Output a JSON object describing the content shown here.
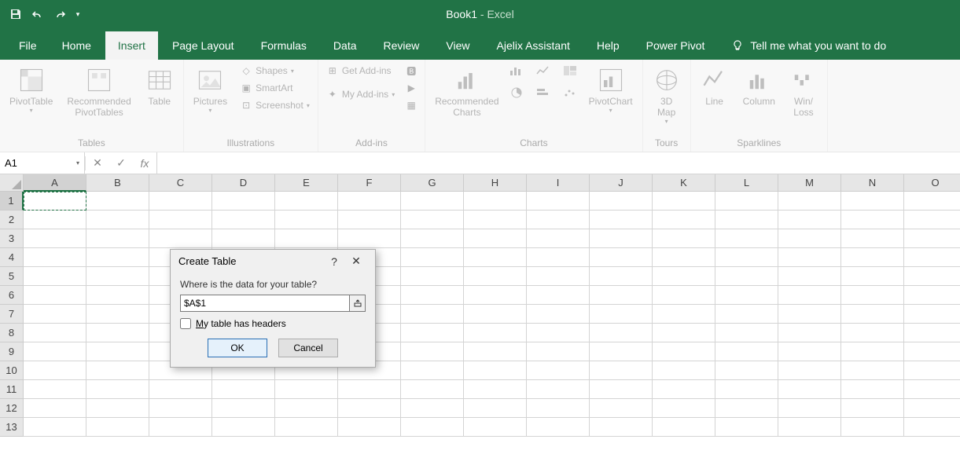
{
  "title": {
    "book": "Book1",
    "separator": " - ",
    "app": "Excel"
  },
  "tabs": {
    "file": "File",
    "home": "Home",
    "insert": "Insert",
    "page_layout": "Page Layout",
    "formulas": "Formulas",
    "data": "Data",
    "review": "Review",
    "view": "View",
    "ajelix": "Ajelix Assistant",
    "help": "Help",
    "powerpivot": "Power Pivot",
    "tellme": "Tell me what you want to do"
  },
  "ribbon": {
    "tables": {
      "pivot": "PivotTable",
      "recpivot": "Recommended\nPivotTables",
      "table": "Table",
      "label": "Tables"
    },
    "illustrations": {
      "pictures": "Pictures",
      "shapes": "Shapes",
      "smartart": "SmartArt",
      "screenshot": "Screenshot",
      "label": "Illustrations"
    },
    "addins": {
      "get": "Get Add-ins",
      "my": "My Add-ins",
      "label": "Add-ins"
    },
    "charts": {
      "rec": "Recommended\nCharts",
      "pivotchart": "PivotChart",
      "label": "Charts"
    },
    "tours": {
      "map3d": "3D\nMap",
      "label": "Tours"
    },
    "sparklines": {
      "line": "Line",
      "column": "Column",
      "winloss": "Win/\nLoss",
      "label": "Sparklines"
    }
  },
  "formula_bar": {
    "namebox": "A1"
  },
  "columns": [
    "A",
    "B",
    "C",
    "D",
    "E",
    "F",
    "G",
    "H",
    "I",
    "J",
    "K",
    "L",
    "M",
    "N",
    "O"
  ],
  "rows": [
    "1",
    "2",
    "3",
    "4",
    "5",
    "6",
    "7",
    "8",
    "9",
    "10",
    "11",
    "12",
    "13"
  ],
  "dialog": {
    "title": "Create Table",
    "prompt": "Where is the data for your table?",
    "range": "$A$1",
    "checkbox": "My table has headers",
    "ok": "OK",
    "cancel": "Cancel"
  }
}
